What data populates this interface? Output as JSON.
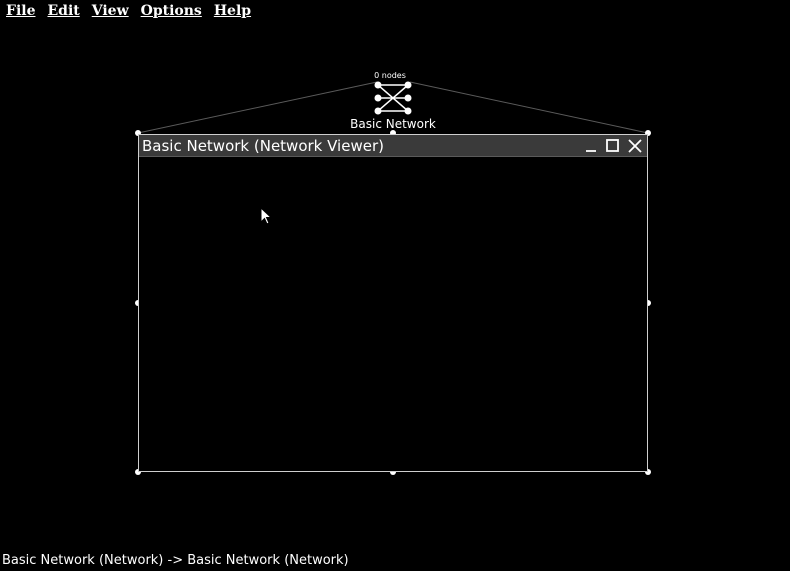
{
  "menubar": {
    "items": [
      {
        "label": "File"
      },
      {
        "label": "Edit"
      },
      {
        "label": "View"
      },
      {
        "label": "Options"
      },
      {
        "label": "Help"
      }
    ]
  },
  "network_node": {
    "count_label": "0 nodes",
    "name": "Basic Network",
    "icon": "network-graph-icon"
  },
  "viewer_window": {
    "title": "Basic Network (Network Viewer)",
    "controls": [
      "minimize-icon",
      "maximize-icon",
      "close-icon"
    ]
  },
  "statusbar": {
    "text": "Basic Network (Network) -> Basic Network (Network)"
  },
  "colors": {
    "background": "#000000",
    "foreground": "#ffffff",
    "titlebar": "#3a3a3a",
    "connector": "#5a5a5a"
  }
}
